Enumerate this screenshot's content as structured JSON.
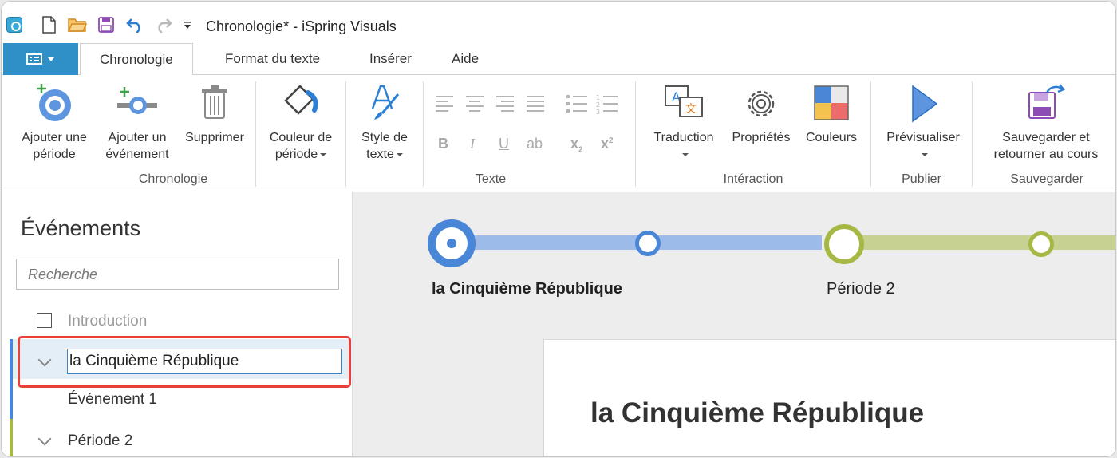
{
  "window": {
    "title": "Chronologie* - iSpring Visuals"
  },
  "tabs": [
    {
      "label": "Chronologie"
    },
    {
      "label": "Format du texte"
    },
    {
      "label": "Insérer"
    },
    {
      "label": "Aide"
    }
  ],
  "ribbon": {
    "chronologie": {
      "add_period_l1": "Ajouter une",
      "add_period_l2": "période",
      "add_event_l1": "Ajouter un",
      "add_event_l2": "événement",
      "delete": "Supprimer",
      "period_color_l1": "Couleur de",
      "period_color_l2": "période",
      "group": "Chronologie"
    },
    "texte": {
      "text_style_l1": "Style de",
      "text_style_l2": "texte",
      "bold": "B",
      "italic": "I",
      "underline": "U",
      "strike": "ab",
      "subscript": "x",
      "subscript_mark": "2",
      "superscript": "x",
      "superscript_mark": "2",
      "group": "Texte"
    },
    "interaction": {
      "translation": "Traduction",
      "properties": "Propriétés",
      "colors": "Couleurs",
      "group": "Intéraction"
    },
    "publier": {
      "preview": "Prévisualiser",
      "group": "Publier"
    },
    "sauvegarder": {
      "save_l1": "Sauvegarder et",
      "save_l2": "retourner au cours",
      "group": "Sauvegarder"
    }
  },
  "events_panel": {
    "title": "Événements",
    "search_placeholder": "Recherche",
    "items": [
      {
        "label": "Introduction"
      },
      {
        "label": "la Cinquième République"
      },
      {
        "label": "Événement 1"
      },
      {
        "label": "Période 2"
      }
    ]
  },
  "timeline": {
    "period1_label": "la Cinquième République",
    "period2_label": "Période 2",
    "card_title": "la Cinquième République"
  },
  "colors": {
    "accent": "#2f90c8",
    "period1": "#4a86d8",
    "period2": "#a8b844",
    "highlight": "#e6423a"
  }
}
